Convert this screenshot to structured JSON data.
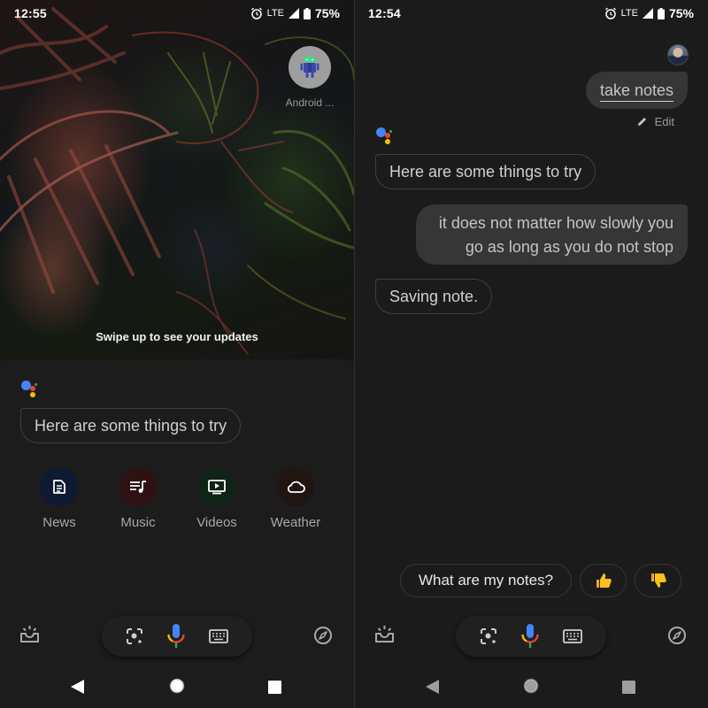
{
  "left_screen": {
    "status_bar": {
      "time": "12:55",
      "network": "LTE",
      "battery_percent": "75%",
      "icons": [
        "alarm-icon",
        "signal-icon",
        "battery-icon"
      ]
    },
    "home_shortcut": {
      "label": "Android ...",
      "icon": "android-robot-icon"
    },
    "swipe_hint": "Swipe up to see your updates",
    "assistant": {
      "message": "Here are some things to try",
      "suggestions": [
        {
          "label": "News",
          "icon": "news-article-icon",
          "color": "#0e1a33"
        },
        {
          "label": "Music",
          "icon": "music-queue-icon",
          "color": "#2e1213"
        },
        {
          "label": "Videos",
          "icon": "video-play-icon",
          "color": "#0f2316"
        },
        {
          "label": "Weather",
          "icon": "cloud-icon",
          "color": "#1f1511"
        }
      ]
    },
    "action_bar": {
      "left_icon": "updates-tray-icon",
      "center": [
        "lens-icon",
        "microphone-icon",
        "keyboard-icon"
      ],
      "right_icon": "explore-compass-icon"
    },
    "nav_bar": [
      "back",
      "home",
      "recents"
    ]
  },
  "right_screen": {
    "status_bar": {
      "time": "12:54",
      "network": "LTE",
      "battery_percent": "75%"
    },
    "conversation": {
      "user_query": "take notes",
      "edit_label": "Edit",
      "assistant_reply_1": "Here are some things to try",
      "user_note_line1": "it does not matter how slowly you",
      "user_note_line2": "go as long as you do not stop",
      "assistant_reply_2": "Saving note."
    },
    "quick_replies": {
      "suggestion": "What are my notes?",
      "thumbs_up": "👍",
      "thumbs_down": "👎"
    }
  },
  "colors": {
    "google_blue": "#4285f4",
    "google_red": "#ea4335",
    "google_yellow": "#fbbc04",
    "google_green": "#34a853",
    "background": "#1c1c1c"
  }
}
